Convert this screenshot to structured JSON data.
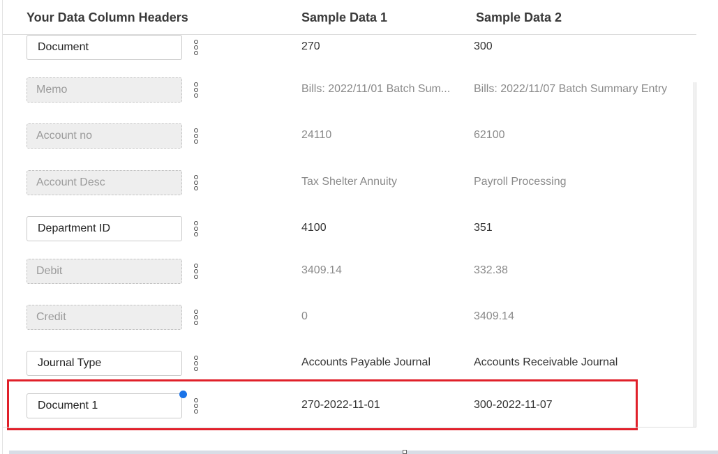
{
  "header": {
    "col_headers": "Your Data Column Headers",
    "sample1": "Sample Data 1",
    "sample2": "Sample Data 2"
  },
  "rows": [
    {
      "field": "Document",
      "disabled": false,
      "sample1": "270",
      "sample2": "300"
    },
    {
      "field": "Memo",
      "disabled": true,
      "sample1": "Bills: 2022/11/01 Batch Sum...",
      "sample2": "Bills: 2022/11/07 Batch Summary Entry"
    },
    {
      "field": "Account no",
      "disabled": true,
      "sample1": "24110",
      "sample2": "62100"
    },
    {
      "field": "Account Desc",
      "disabled": true,
      "sample1": "Tax Shelter Annuity",
      "sample2": "Payroll Processing"
    },
    {
      "field": "Department ID",
      "disabled": false,
      "sample1": "4100",
      "sample2": "351"
    },
    {
      "field": "Debit",
      "disabled": true,
      "sample1": "3409.14",
      "sample2": "332.38"
    },
    {
      "field": "Credit",
      "disabled": true,
      "sample1": "0",
      "sample2": "3409.14"
    },
    {
      "field": "Journal Type",
      "disabled": false,
      "sample1": "Accounts Payable Journal",
      "sample2": "Accounts Receivable Journal"
    },
    {
      "field": "Document 1",
      "disabled": false,
      "sample1": "270-2022-11-01",
      "sample2": "300-2022-11-07"
    }
  ],
  "colors": {
    "highlight": "#e0202a",
    "indicator": "#1a73e8"
  }
}
